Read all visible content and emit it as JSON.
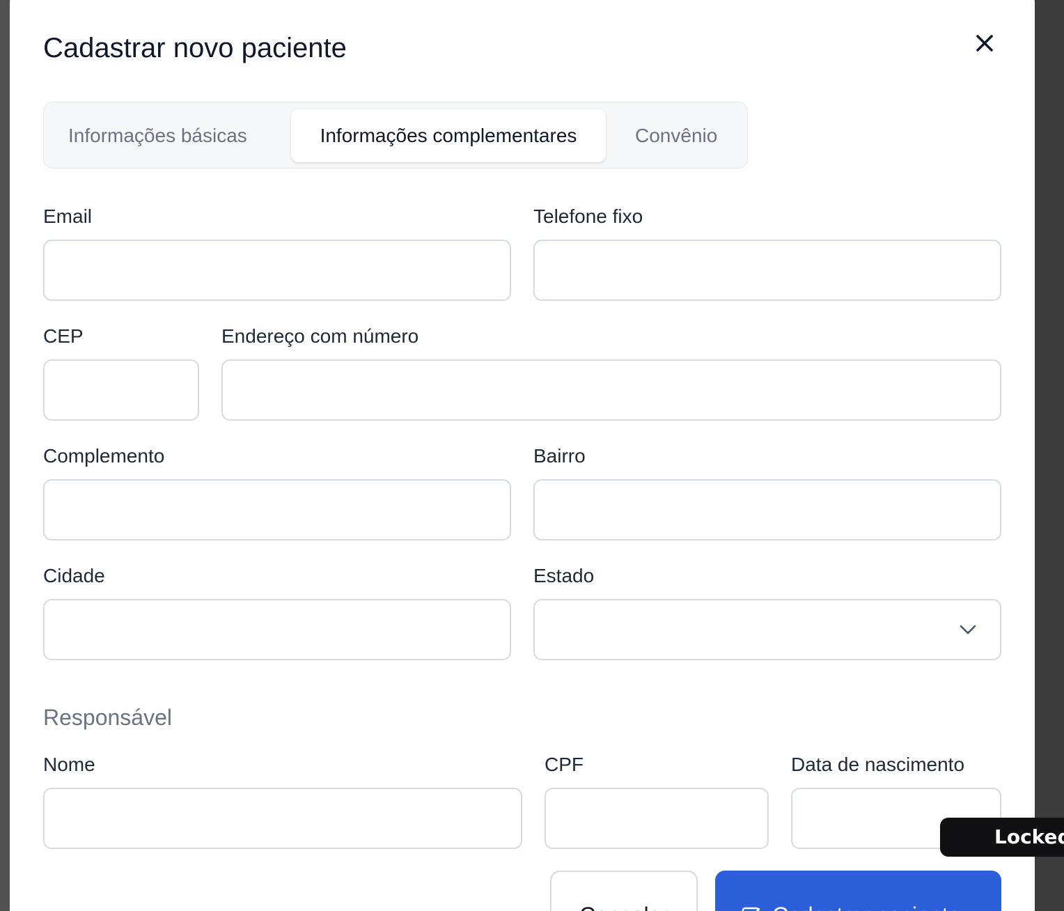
{
  "modal": {
    "title": "Cadastrar novo paciente",
    "close_icon": "close-icon"
  },
  "tabs": [
    {
      "label": "Informações básicas",
      "active": false
    },
    {
      "label": "Informações complementares",
      "active": true
    },
    {
      "label": "Convênio",
      "active": false
    }
  ],
  "fields": {
    "email": {
      "label": "Email",
      "value": ""
    },
    "telefone_fixo": {
      "label": "Telefone fixo",
      "value": ""
    },
    "cep": {
      "label": "CEP",
      "value": ""
    },
    "endereco": {
      "label": "Endereço com número",
      "value": ""
    },
    "complemento": {
      "label": "Complemento",
      "value": ""
    },
    "bairro": {
      "label": "Bairro",
      "value": ""
    },
    "cidade": {
      "label": "Cidade",
      "value": ""
    },
    "estado": {
      "label": "Estado",
      "value": "",
      "icon": "chevron-down-icon"
    }
  },
  "responsavel": {
    "section_title": "Responsável",
    "nome": {
      "label": "Nome",
      "value": ""
    },
    "cpf": {
      "label": "CPF",
      "value": ""
    },
    "data_nascimento": {
      "label": "Data de nascimento",
      "value": ""
    }
  },
  "actions": {
    "cancel_label": "Cancelar",
    "submit_label": "Cadastrar paciente",
    "submit_icon": "check-square-icon",
    "submit_color": "#2b5fd9"
  },
  "overlay": {
    "locked_label": "Locked"
  }
}
